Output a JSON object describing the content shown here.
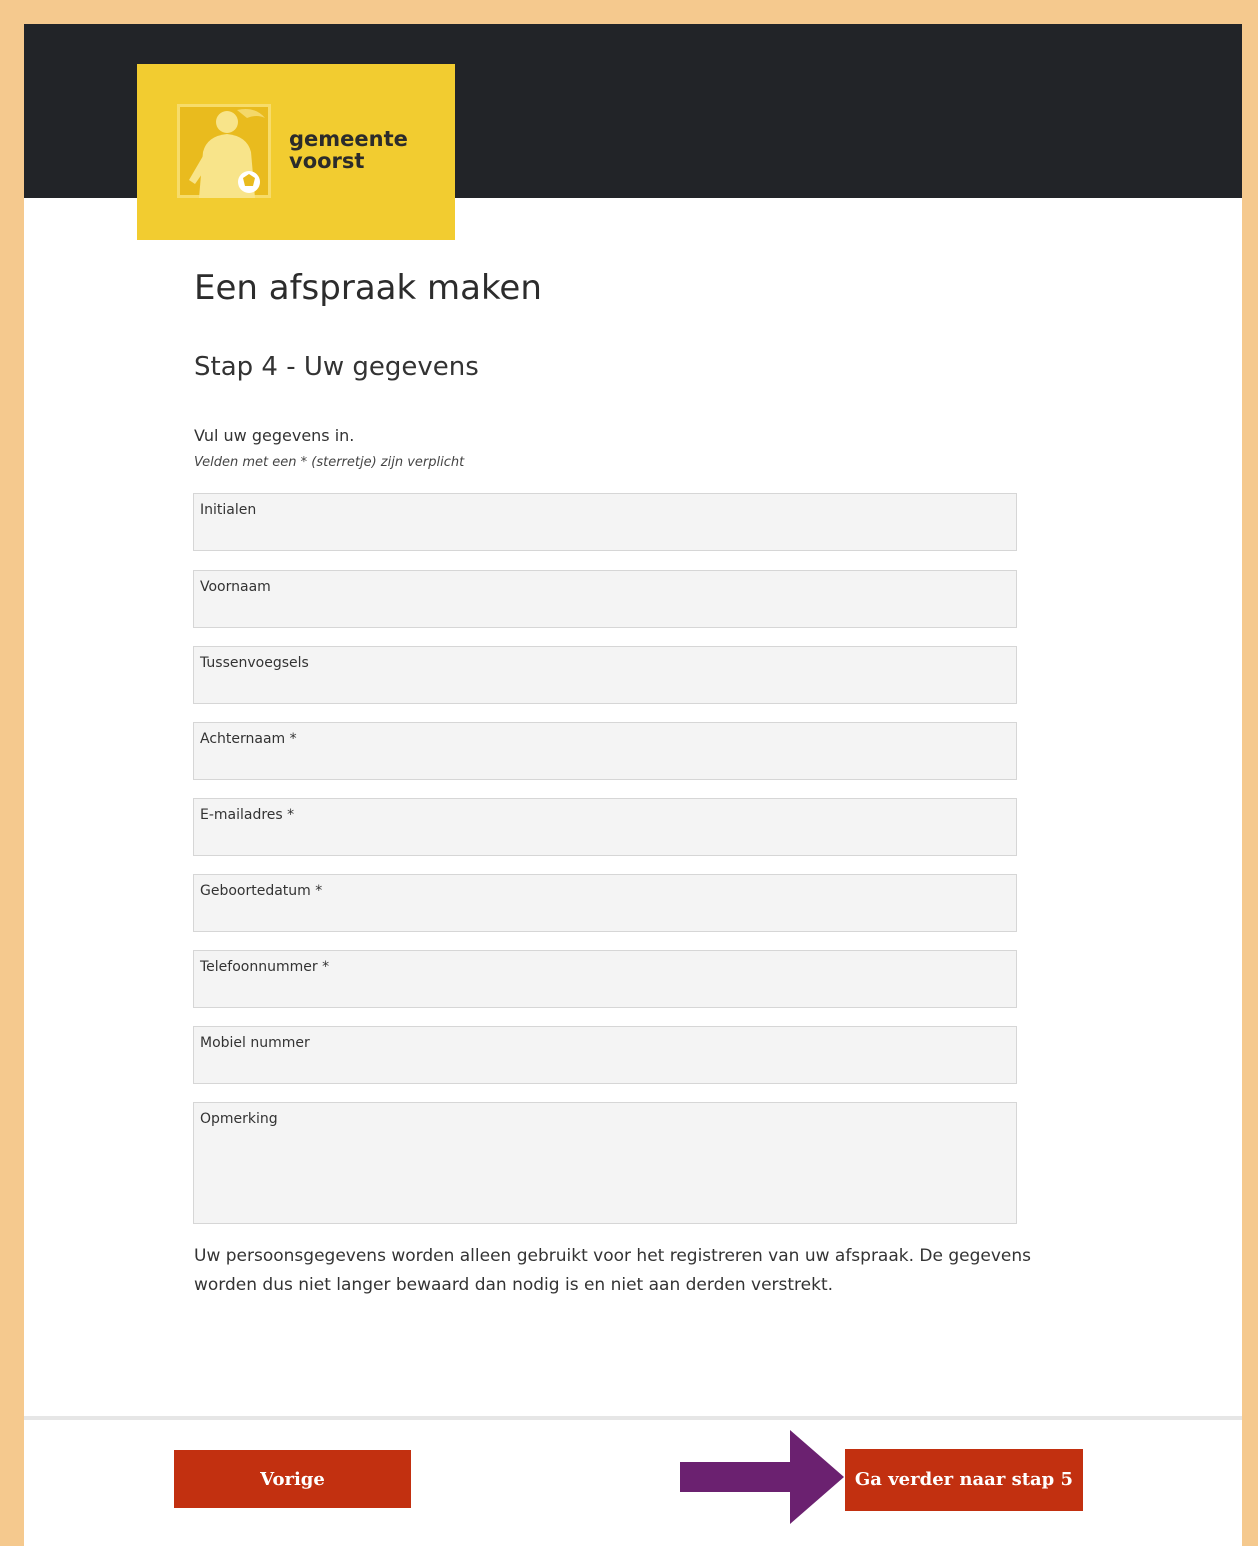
{
  "header": {
    "logo_line1": "gemeente",
    "logo_line2": "voorst"
  },
  "main": {
    "title": "Een afspraak maken",
    "step_title": "Stap 4 - Uw gegevens",
    "intro": "Vul uw gegevens in.",
    "required_note": "Velden met een * (sterretje) zijn verplicht",
    "fields": [
      {
        "label": "Initialen"
      },
      {
        "label": "Voornaam"
      },
      {
        "label": "Tussenvoegsels"
      },
      {
        "label": "Achternaam *"
      },
      {
        "label": "E-mailadres *"
      },
      {
        "label": "Geboortedatum *"
      },
      {
        "label": "Telefoonnummer *"
      },
      {
        "label": "Mobiel nummer"
      },
      {
        "label": "Opmerking"
      }
    ],
    "privacy_text": "Uw persoonsgegevens worden alleen gebruikt voor het registreren van uw afspraak. De gegevens worden dus niet langer bewaard dan nodig is en niet aan derden verstrekt."
  },
  "footer": {
    "prev_label": "Vorige",
    "next_label": "Ga verder naar stap 5"
  },
  "colors": {
    "frame_border": "#f5c98e",
    "header_bg": "#222428",
    "logo_bg": "#f2cc30",
    "button_bg": "#c23010",
    "arrow": "#6b2170"
  },
  "icons": {
    "logo": "person-with-ball-icon",
    "arrow": "right-arrow-icon"
  }
}
